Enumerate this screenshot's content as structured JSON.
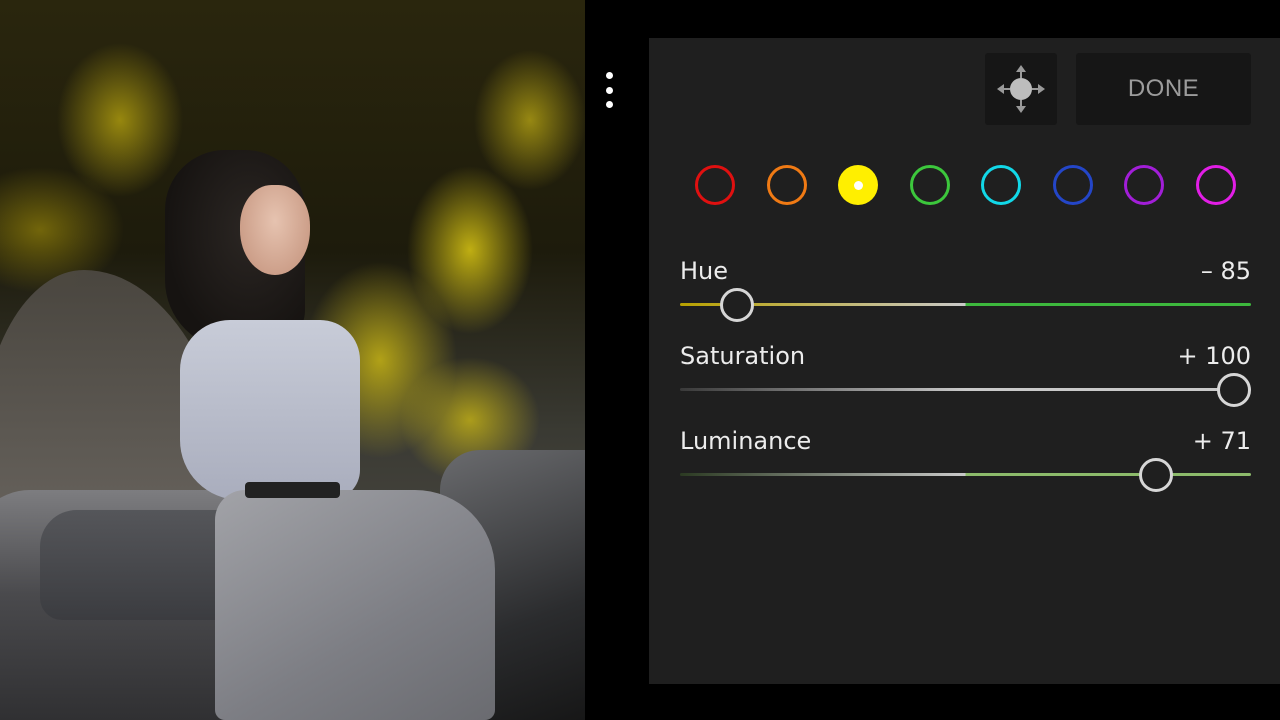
{
  "menu": {
    "icon": "more-vert-icon"
  },
  "toolbar": {
    "target_icon": "targeted-adjustment-icon",
    "done_label": "DONE"
  },
  "colors": [
    {
      "name": "red",
      "hex": "#e01010",
      "selected": false
    },
    {
      "name": "orange",
      "hex": "#f07a14",
      "selected": false
    },
    {
      "name": "yellow",
      "hex": "#ffef00",
      "selected": true
    },
    {
      "name": "green",
      "hex": "#3cc73c",
      "selected": false
    },
    {
      "name": "aqua",
      "hex": "#12d8e8",
      "selected": false
    },
    {
      "name": "blue",
      "hex": "#2446c8",
      "selected": false
    },
    {
      "name": "purple",
      "hex": "#a21ed8",
      "selected": false
    },
    {
      "name": "magenta",
      "hex": "#e21ee6",
      "selected": false
    }
  ],
  "sliders": [
    {
      "id": "hue",
      "label": "Hue",
      "value_text": "– 85",
      "value": -85,
      "min": -100,
      "max": 100,
      "track_gradient": [
        "#b8a100",
        "#c9c9c9",
        "#3db83d"
      ]
    },
    {
      "id": "saturation",
      "label": "Saturation",
      "value_text": "+ 100",
      "value": 100,
      "min": -100,
      "max": 100,
      "track_gradient": [
        "#3a3a3a",
        "#c9c9c9",
        "#c9c9c9"
      ]
    },
    {
      "id": "luminance",
      "label": "Luminance",
      "value_text": "+ 71",
      "value": 71,
      "min": -100,
      "max": 100,
      "track_gradient": [
        "#2b3a22",
        "#c9c9c9",
        "#8dbb6b"
      ]
    }
  ]
}
